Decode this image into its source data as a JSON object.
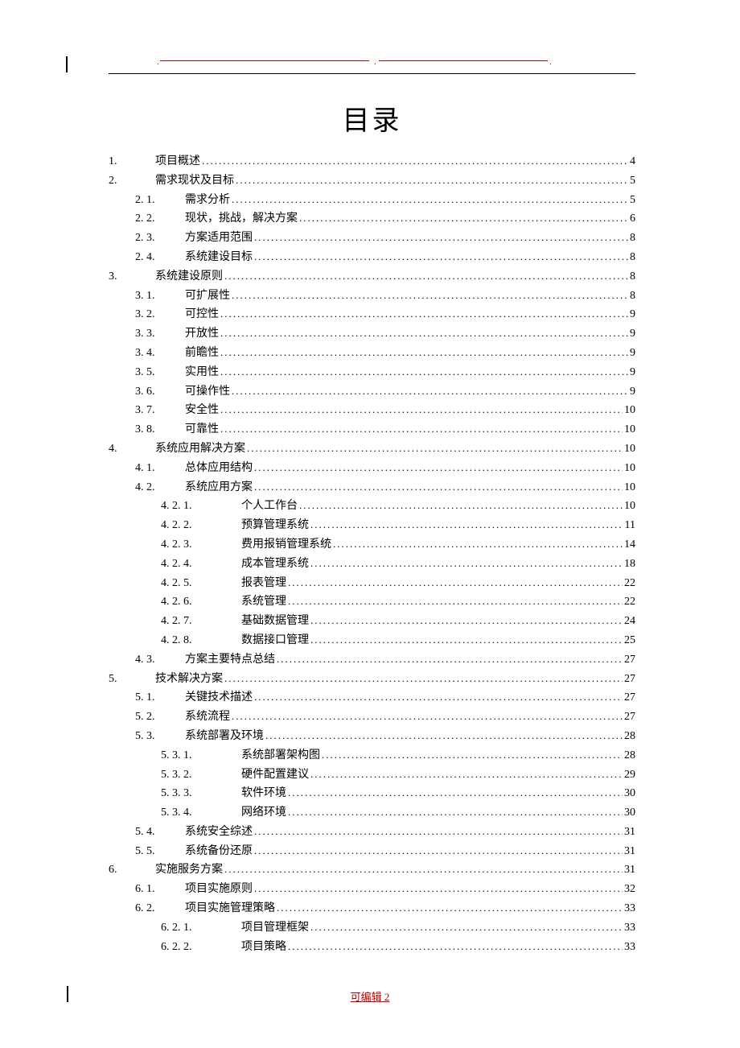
{
  "title": "目录",
  "footer": "可编辑 2",
  "entries": [
    {
      "level": 1,
      "num": "1.",
      "text": "项目概述",
      "page": "4"
    },
    {
      "level": 1,
      "num": "2.",
      "text": "需求现状及目标",
      "page": "5"
    },
    {
      "level": 2,
      "num": "2. 1.",
      "text": "需求分析",
      "page": "5"
    },
    {
      "level": 2,
      "num": "2. 2.",
      "text": "现状，挑战，解决方案",
      "page": "6"
    },
    {
      "level": 2,
      "num": "2. 3.",
      "text": "方案适用范围",
      "page": "8"
    },
    {
      "level": 2,
      "num": "2. 4.",
      "text": "系统建设目标",
      "page": "8"
    },
    {
      "level": 1,
      "num": "3.",
      "text": "系统建设原则",
      "page": "8"
    },
    {
      "level": 2,
      "num": "3. 1.",
      "text": "可扩展性",
      "page": "8"
    },
    {
      "level": 2,
      "num": "3. 2.",
      "text": "可控性",
      "page": "9"
    },
    {
      "level": 2,
      "num": "3. 3.",
      "text": "开放性",
      "page": "9"
    },
    {
      "level": 2,
      "num": "3. 4.",
      "text": "前瞻性",
      "page": "9"
    },
    {
      "level": 2,
      "num": "3. 5.",
      "text": "实用性",
      "page": "9"
    },
    {
      "level": 2,
      "num": "3. 6.",
      "text": "可操作性",
      "page": "9"
    },
    {
      "level": 2,
      "num": "3. 7.",
      "text": "安全性",
      "page": "10"
    },
    {
      "level": 2,
      "num": "3. 8.",
      "text": "可靠性",
      "page": "10"
    },
    {
      "level": 1,
      "num": "4.",
      "text": "系统应用解决方案",
      "page": "10"
    },
    {
      "level": 2,
      "num": "4. 1.",
      "text": "总体应用结构",
      "page": "10"
    },
    {
      "level": 2,
      "num": "4. 2.",
      "text": "系统应用方案",
      "page": "10"
    },
    {
      "level": 3,
      "num": "4. 2. 1.",
      "text": "个人工作台",
      "page": "10"
    },
    {
      "level": 3,
      "num": "4. 2. 2.",
      "text": "预算管理系统",
      "page": "11"
    },
    {
      "level": 3,
      "num": "4. 2. 3.",
      "text": "费用报销管理系统",
      "page": "14"
    },
    {
      "level": 3,
      "num": "4. 2. 4.",
      "text": "成本管理系统",
      "page": "18"
    },
    {
      "level": 3,
      "num": "4. 2. 5.",
      "text": "报表管理",
      "page": "22"
    },
    {
      "level": 3,
      "num": "4. 2. 6.",
      "text": "系统管理",
      "page": "22"
    },
    {
      "level": 3,
      "num": "4. 2. 7.",
      "text": "基础数据管理",
      "page": "24"
    },
    {
      "level": 3,
      "num": "4. 2. 8.",
      "text": "数据接口管理",
      "page": "25"
    },
    {
      "level": 2,
      "num": "4. 3.",
      "text": "方案主要特点总结",
      "page": "27"
    },
    {
      "level": 1,
      "num": "5.",
      "text": "技术解决方案",
      "page": "27"
    },
    {
      "level": 2,
      "num": "5. 1.",
      "text": "关键技术描述",
      "page": "27"
    },
    {
      "level": 2,
      "num": "5. 2.",
      "text": "系统流程",
      "page": "27"
    },
    {
      "level": 2,
      "num": "5. 3.",
      "text": "系统部署及环境",
      "page": "28"
    },
    {
      "level": 3,
      "num": "5. 3. 1.",
      "text": "系统部署架构图",
      "page": "28"
    },
    {
      "level": 3,
      "num": "5. 3. 2.",
      "text": "硬件配置建议",
      "page": "29"
    },
    {
      "level": 3,
      "num": "5. 3. 3.",
      "text": "软件环境",
      "page": "30"
    },
    {
      "level": 3,
      "num": "5. 3. 4.",
      "text": "网络环境",
      "page": "30"
    },
    {
      "level": 2,
      "num": "5. 4.",
      "text": "系统安全综述",
      "page": "31"
    },
    {
      "level": 2,
      "num": "5. 5.",
      "text": "系统备份还原",
      "page": "31"
    },
    {
      "level": 1,
      "num": "6.",
      "text": "实施服务方案",
      "page": "31"
    },
    {
      "level": 2,
      "num": "6. 1.",
      "text": "项目实施原则",
      "page": "32"
    },
    {
      "level": 2,
      "num": "6. 2.",
      "text": "项目实施管理策略",
      "page": "33"
    },
    {
      "level": 3,
      "num": "6. 2. 1.",
      "text": "项目管理框架",
      "page": "33"
    },
    {
      "level": 3,
      "num": "6. 2. 2.",
      "text": "项目策略",
      "page": "33"
    }
  ]
}
